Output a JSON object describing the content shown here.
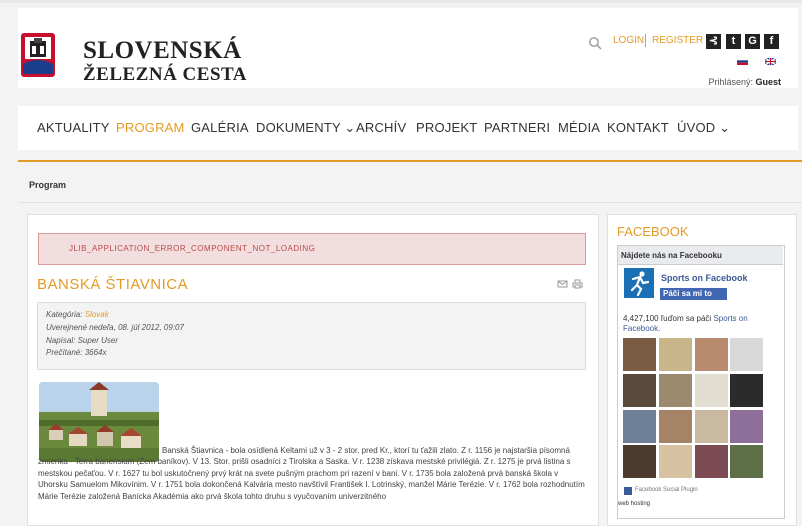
{
  "site": {
    "title_line1": "SLOVENSKÁ",
    "title_line2": "ŽELEZNÁ CESTA",
    "login": "LOGIN",
    "register": "REGISTER",
    "logged_in_label": "Prihlásený:",
    "logged_in_user": "Guest",
    "social": [
      "rss-icon",
      "tumblr-icon",
      "google-icon",
      "facebook-icon"
    ],
    "social_glyphs": [
      "⊰",
      "t",
      "G",
      "f"
    ],
    "accent_color": "#e39b25"
  },
  "nav": {
    "items": [
      {
        "label": "AKTUALITY"
      },
      {
        "label": "PROGRAM"
      },
      {
        "label": "GALÉRIA"
      },
      {
        "label": "DOKUMENTY ⌄"
      },
      {
        "label": "ARCHÍV"
      },
      {
        "label": "PROJEKT"
      },
      {
        "label": "PARTNERI"
      },
      {
        "label": "MÉDIA"
      },
      {
        "label": "KONTAKT"
      },
      {
        "label": "ÚVOD ⌄"
      }
    ],
    "active_index": 1
  },
  "breadcrumb": "Program",
  "alert": "JLIB_APPLICATION_ERROR_COMPONENT_NOT_LOADING",
  "article": {
    "title": "BANSKÁ ŠTIAVNICA",
    "category_label": "Kategória:",
    "category_value": "Slovak",
    "published": "Uverejnené nedeľa, 08. júl 2012, 09:07",
    "author": "Napísal: Super User",
    "hits": "Prečítané: 3664x",
    "body": "Banská Štiavnica - bola osídlená Keltami už v 3 - 2 stor. pred Kr., ktorí tu ťažili zlato. Z r. 1156 je najstaršia písomná zmienka - Terra banensium (Zem baníkov). V 13. Stor. prišli osadníci z Tirolska a Saska. V r. 1238 získava mestské privilégiá. Z r. 1275 je prvá listina s mestskou pečaťou. V r. 1627 tu bol uskutočnený prvý krát na svete pušným prachom pri razení v bani. V r. 1735 bola založená prvá banská škola v Uhorsku Samuelom Mikovínim. V r. 1751 bola dokončená Kalvária mesto navštívil František I. Lotrinský, manžel Márie Terézie. V r. 1762 bola rozhodnutím Márie Terézie založená Banícka Akadémia ako prvá škola tohto druhu s vyučovaním univerzitného"
  },
  "sidebar": {
    "title": "FACEBOOK",
    "box_title": "Nájdete nás na Facebooku",
    "page_name": "Sports on Facebook",
    "like_label": "Páči sa mi to",
    "count_text": "4,427,100 ľuďom sa páči",
    "count_link": "Sports on Facebook.",
    "plugin_label": "Facebook Social Plugin",
    "web_hosting": "web hosting"
  }
}
